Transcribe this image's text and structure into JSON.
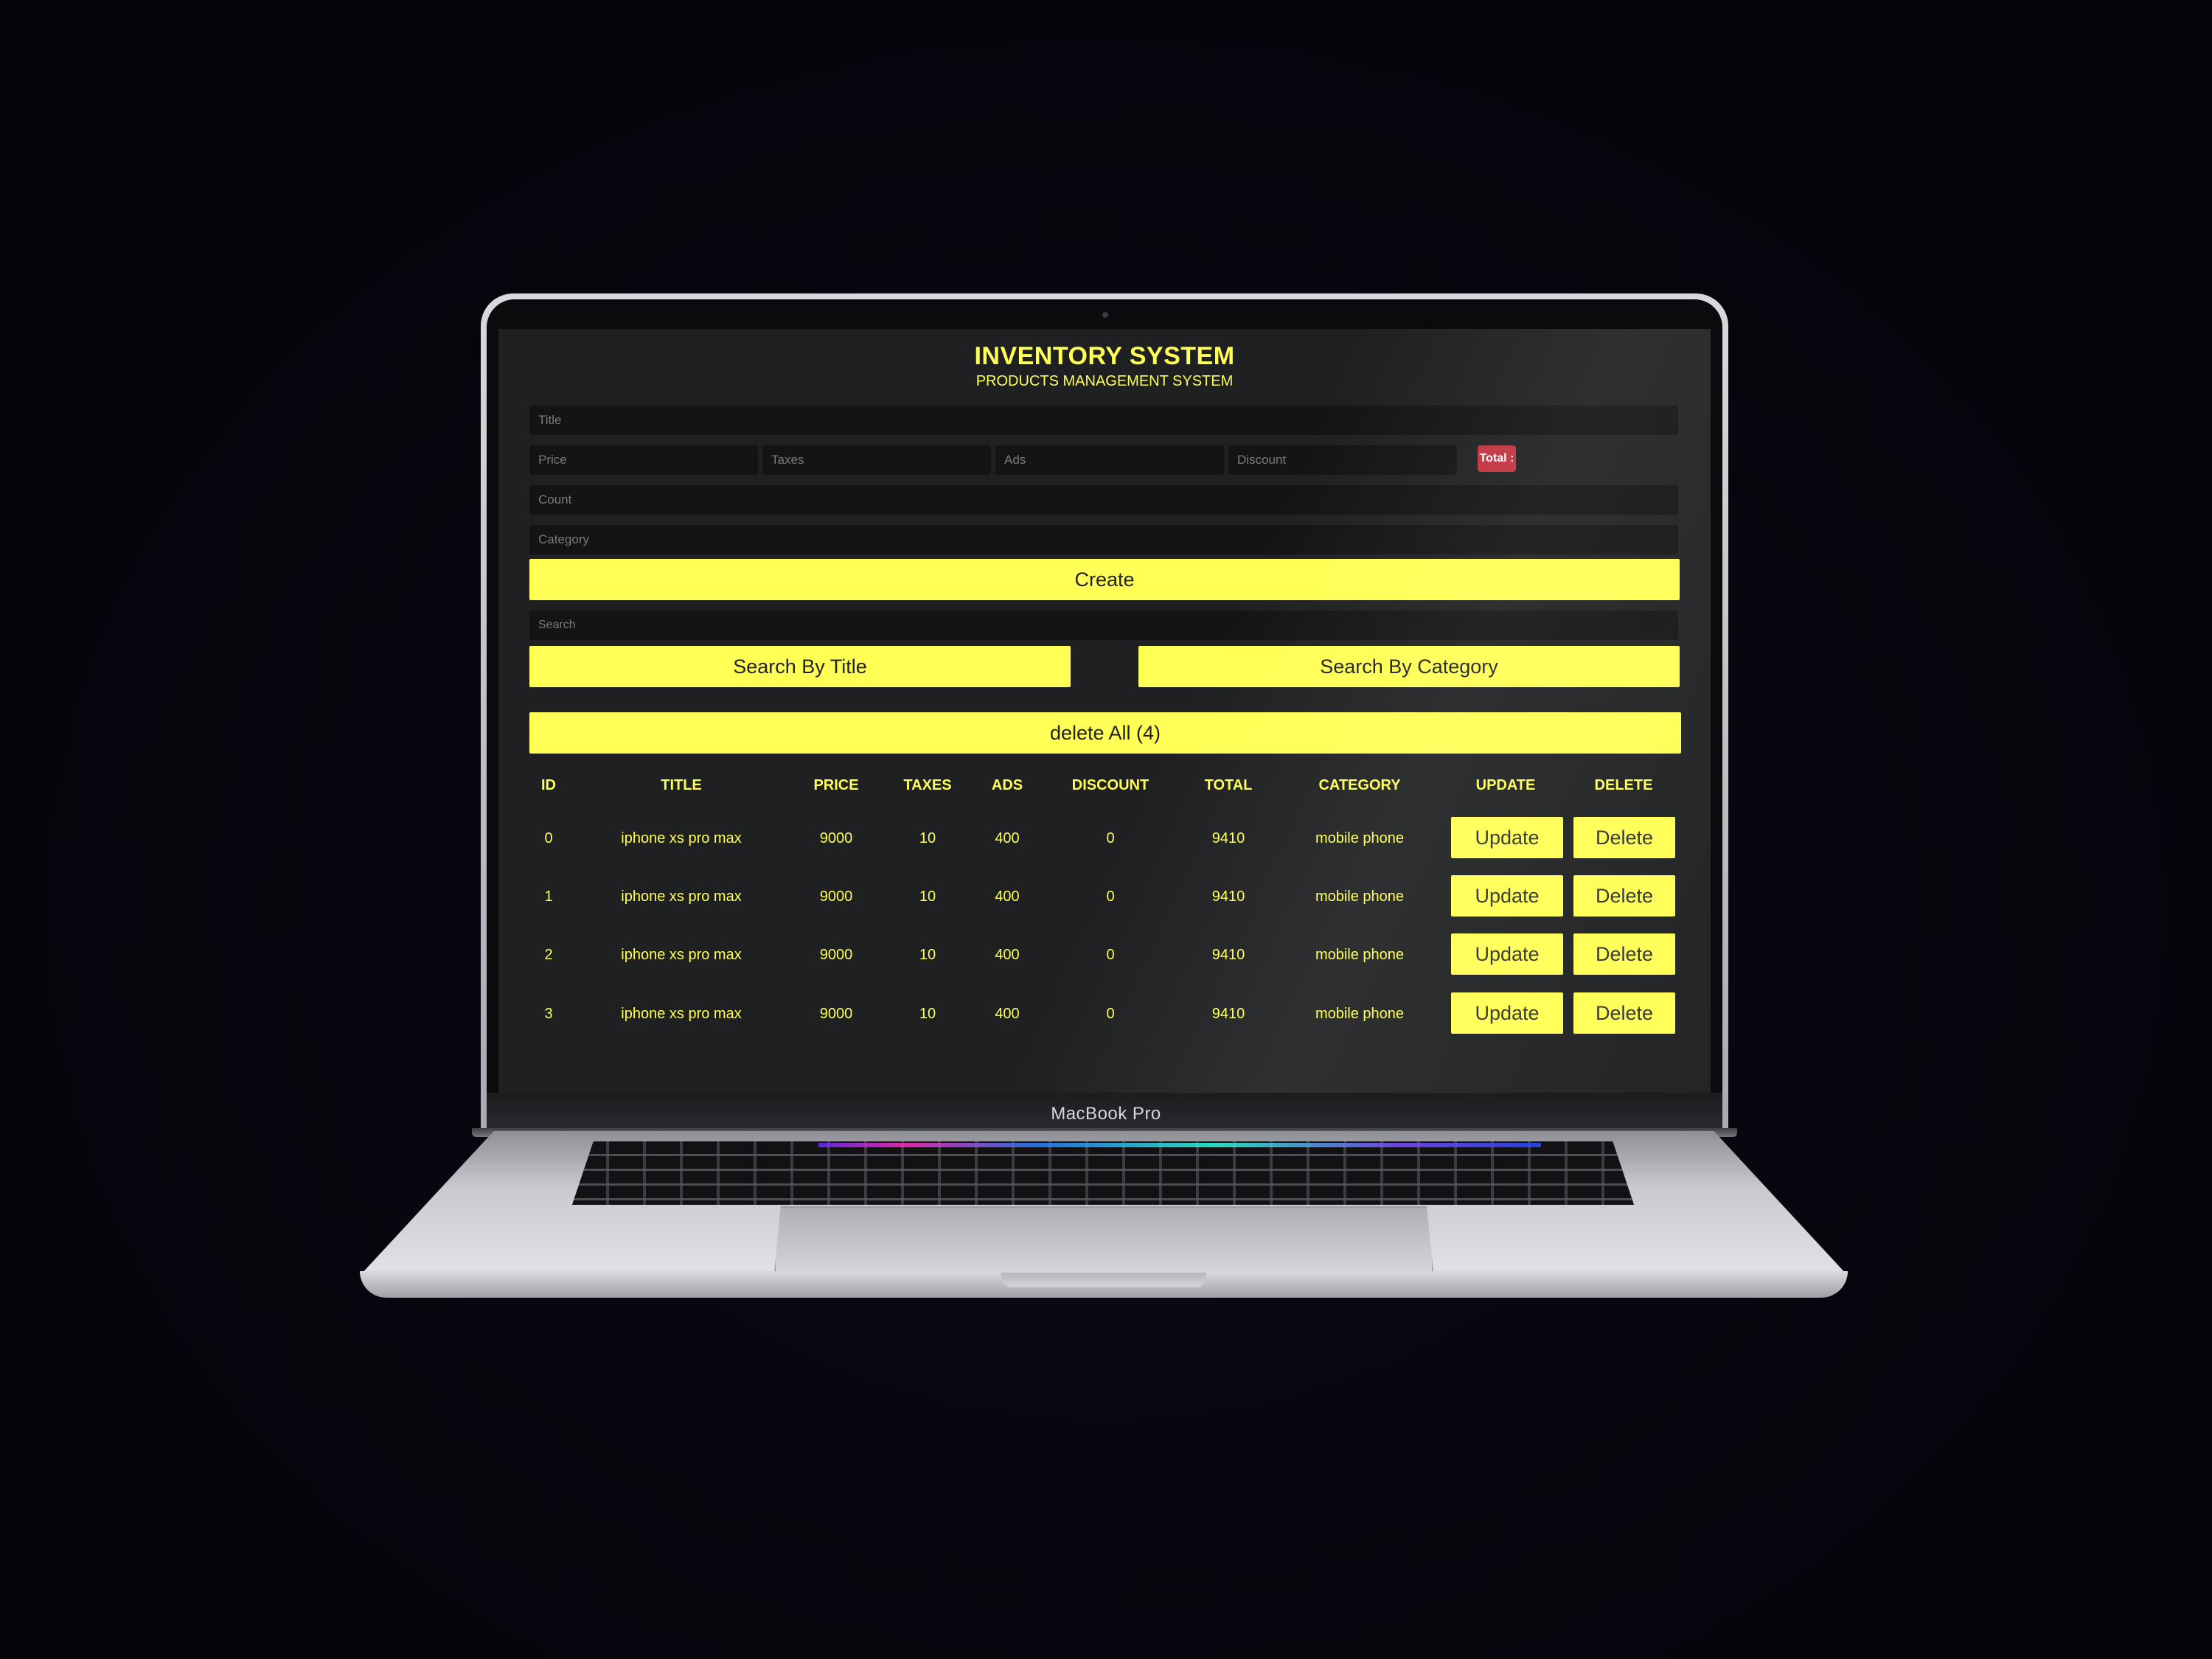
{
  "device": {
    "label": "MacBook Pro"
  },
  "app": {
    "title": "INVENTORY SYSTEM",
    "subtitle": "PRODUCTS MANAGEMENT SYSTEM",
    "accent_color": "#ffff55",
    "background_color": "#1f2021",
    "form": {
      "title_placeholder": "Title",
      "price_placeholder": "Price",
      "taxes_placeholder": "Taxes",
      "ads_placeholder": "Ads",
      "discount_placeholder": "Discount",
      "total_label": "Total :",
      "count_placeholder": "Count",
      "category_placeholder": "Category",
      "create_label": "Create"
    },
    "search": {
      "placeholder": "Search",
      "by_title_label": "Search By Title",
      "by_category_label": "Search By Category"
    },
    "delete_all_label": "delete All (4)",
    "table": {
      "headers": [
        "ID",
        "TITLE",
        "PRICE",
        "TAXES",
        "ADS",
        "DISCOUNT",
        "TOTAL",
        "CATEGORY",
        "UPDATE",
        "DELETE"
      ],
      "update_label": "Update",
      "delete_label": "Delete",
      "rows": [
        {
          "id": "0",
          "title": "iphone xs pro max",
          "price": "9000",
          "taxes": "10",
          "ads": "400",
          "discount": "0",
          "total": "9410",
          "category": "mobile phone"
        },
        {
          "id": "1",
          "title": "iphone xs pro max",
          "price": "9000",
          "taxes": "10",
          "ads": "400",
          "discount": "0",
          "total": "9410",
          "category": "mobile phone"
        },
        {
          "id": "2",
          "title": "iphone xs pro max",
          "price": "9000",
          "taxes": "10",
          "ads": "400",
          "discount": "0",
          "total": "9410",
          "category": "mobile phone"
        },
        {
          "id": "3",
          "title": "iphone xs pro max",
          "price": "9000",
          "taxes": "10",
          "ads": "400",
          "discount": "0",
          "total": "9410",
          "category": "mobile phone"
        }
      ]
    }
  }
}
